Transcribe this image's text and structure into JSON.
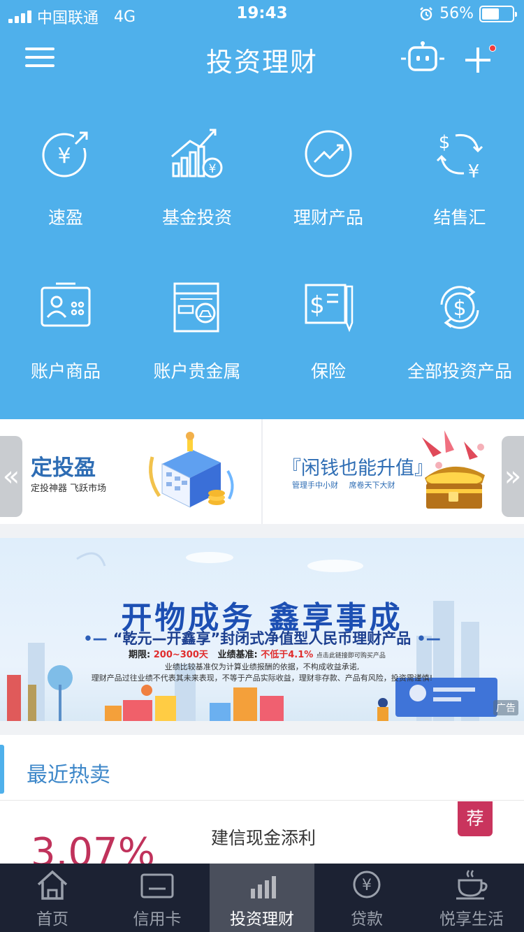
{
  "status_bar": {
    "carrier": "中国联通",
    "network": "4G",
    "time": "19:43",
    "battery_pct": "56%",
    "battery_level": 0.56
  },
  "header": {
    "title": "投资理财"
  },
  "grid": [
    {
      "label": "速盈",
      "icon": "yen-exchange-icon"
    },
    {
      "label": "基金投资",
      "icon": "fund-chart-icon"
    },
    {
      "label": "理财产品",
      "icon": "trend-circle-icon"
    },
    {
      "label": "结售汇",
      "icon": "currency-exchange-icon"
    },
    {
      "label": "账户商品",
      "icon": "account-card-icon"
    },
    {
      "label": "账户贵金属",
      "icon": "gold-bar-icon"
    },
    {
      "label": "保险",
      "icon": "insurance-doc-icon"
    },
    {
      "label": "全部投资产品",
      "icon": "dollar-refresh-icon"
    }
  ],
  "promo": {
    "left_title": "定投盈",
    "left_subtitle": "定投神器 飞跃市场",
    "right_title": "『闲钱也能升值』",
    "right_subtitle": "管理手中小财 席卷天下大财"
  },
  "banner": {
    "title": "开物成务 鑫享事成",
    "subtitle": "“乾元—开鑫享”封闭式净值型人民币理财产品",
    "term_label": "期限:",
    "term_value": "200~300天",
    "bench_label": "业绩基准:",
    "bench_value": "不低于4.1%",
    "cta": "点击此链接即可购买产品",
    "disclaimer_1": "业绩比较基准仅为计算业绩报酬的依据，不构成收益承诺,",
    "disclaimer_2": "理财产品过往业绩不代表其未来表现，不等于产品实际收益，理财非存款、产品有风险，投资需谨慎!",
    "ad_label": "广告"
  },
  "hot": {
    "title": "最近热卖",
    "rate": "3.07%",
    "product_name": "建信现金添利",
    "badge": "荐"
  },
  "tabbar": [
    {
      "label": "首页",
      "icon": "home-icon"
    },
    {
      "label": "信用卡",
      "icon": "credit-card-icon"
    },
    {
      "label": "投资理财",
      "icon": "bar-chart-icon",
      "active": true
    },
    {
      "label": "贷款",
      "icon": "yen-coin-icon"
    },
    {
      "label": "悦享生活",
      "icon": "coffee-cup-icon"
    }
  ],
  "colors": {
    "primary": "#4fb0eb",
    "accent_red": "#c0325b",
    "tabbar_bg": "#1c2233"
  }
}
